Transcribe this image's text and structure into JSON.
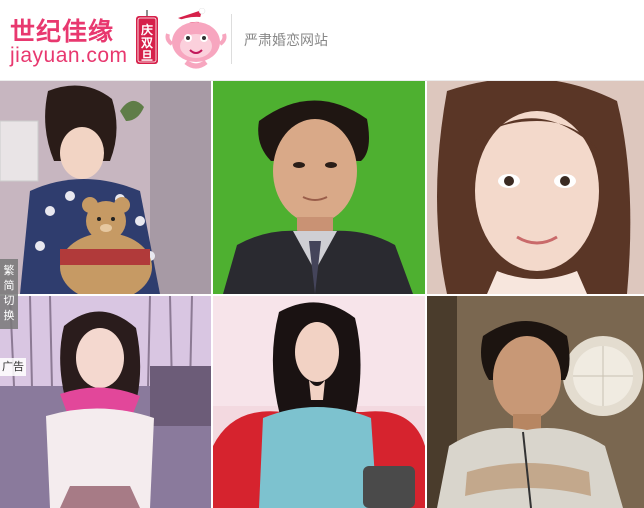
{
  "header": {
    "logo_text": "世纪佳缘",
    "logo_sub": "jiayuan.com",
    "stamp_text": "庆双旦",
    "tagline": "严肃婚恋网站"
  },
  "side_tab": {
    "label": "繁简切换"
  },
  "ad": {
    "label": "广告"
  },
  "colors": {
    "brand": "#e8386f",
    "stamp": "#d6204a",
    "tagline": "#888888"
  },
  "photos": [
    {
      "name": "profile-photo-1"
    },
    {
      "name": "profile-photo-2"
    },
    {
      "name": "profile-photo-3"
    },
    {
      "name": "profile-photo-4"
    },
    {
      "name": "profile-photo-5"
    },
    {
      "name": "profile-photo-6"
    }
  ]
}
